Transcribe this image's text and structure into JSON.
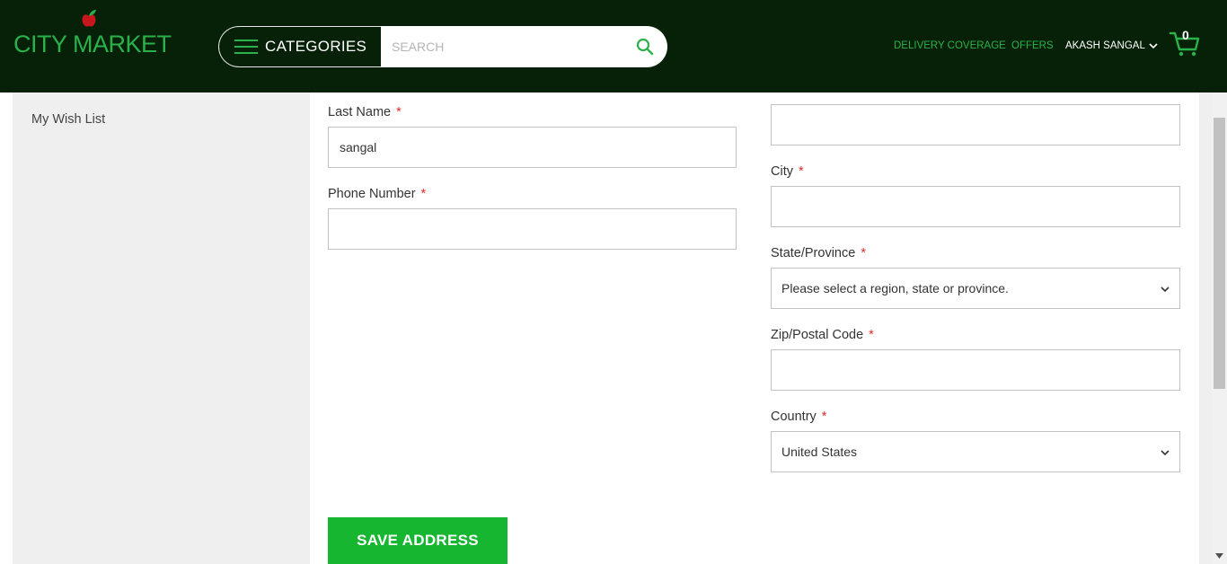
{
  "header": {
    "logo_text": "CITY MARKET",
    "categories_label": "CATEGORIES",
    "search_placeholder": "SEARCH",
    "nav": {
      "delivery": "DELIVERY COVERAGE",
      "offers": "OFFERS",
      "user": "AKASH SANGAL"
    },
    "cart_count": "0"
  },
  "sidebar": {
    "items": [
      {
        "label": "My Wish List"
      }
    ]
  },
  "form": {
    "last_name": {
      "label": "Last Name",
      "required": "*",
      "value": "sangal"
    },
    "phone": {
      "label": "Phone Number",
      "required": "*",
      "value": ""
    },
    "street_line": {
      "value": ""
    },
    "city": {
      "label": "City",
      "required": "*",
      "value": ""
    },
    "state": {
      "label": "State/Province",
      "required": "*",
      "value": "Please select a region, state or province."
    },
    "zip": {
      "label": "Zip/Postal Code",
      "required": "*",
      "value": ""
    },
    "country": {
      "label": "Country",
      "required": "*",
      "value": "United States"
    },
    "save_label": "SAVE ADDRESS"
  },
  "colors": {
    "header_bg": "#062108",
    "accent_green": "#2bb14a",
    "button_green": "#17b630",
    "required_red": "#e02b27"
  },
  "icons": [
    "apple-logo-icon",
    "hamburger-icon",
    "search-icon",
    "chevron-down-icon",
    "cart-icon"
  ]
}
